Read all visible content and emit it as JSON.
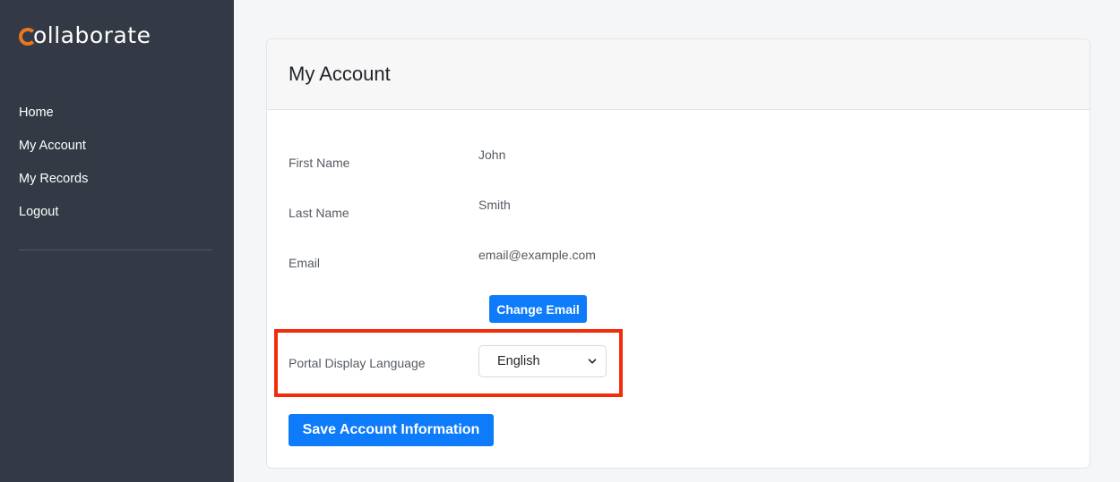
{
  "brand": {
    "name": "ollaborate",
    "accent_color": "#e8771f"
  },
  "sidebar": {
    "items": [
      {
        "label": "Home"
      },
      {
        "label": "My Account"
      },
      {
        "label": "My Records"
      },
      {
        "label": "Logout"
      }
    ]
  },
  "account": {
    "title": "My Account",
    "fields": [
      {
        "label": "First Name",
        "value": "John"
      },
      {
        "label": "Last Name",
        "value": "Smith"
      },
      {
        "label": "Email",
        "value": "email@example.com"
      }
    ],
    "change_email_label": "Change Email",
    "language": {
      "label": "Portal Display Language",
      "selected": "English"
    },
    "save_label": "Save Account Information"
  },
  "colors": {
    "sidebar_bg": "#343a45",
    "primary_button": "#0d7bfa",
    "highlight": "#f22b0a"
  }
}
